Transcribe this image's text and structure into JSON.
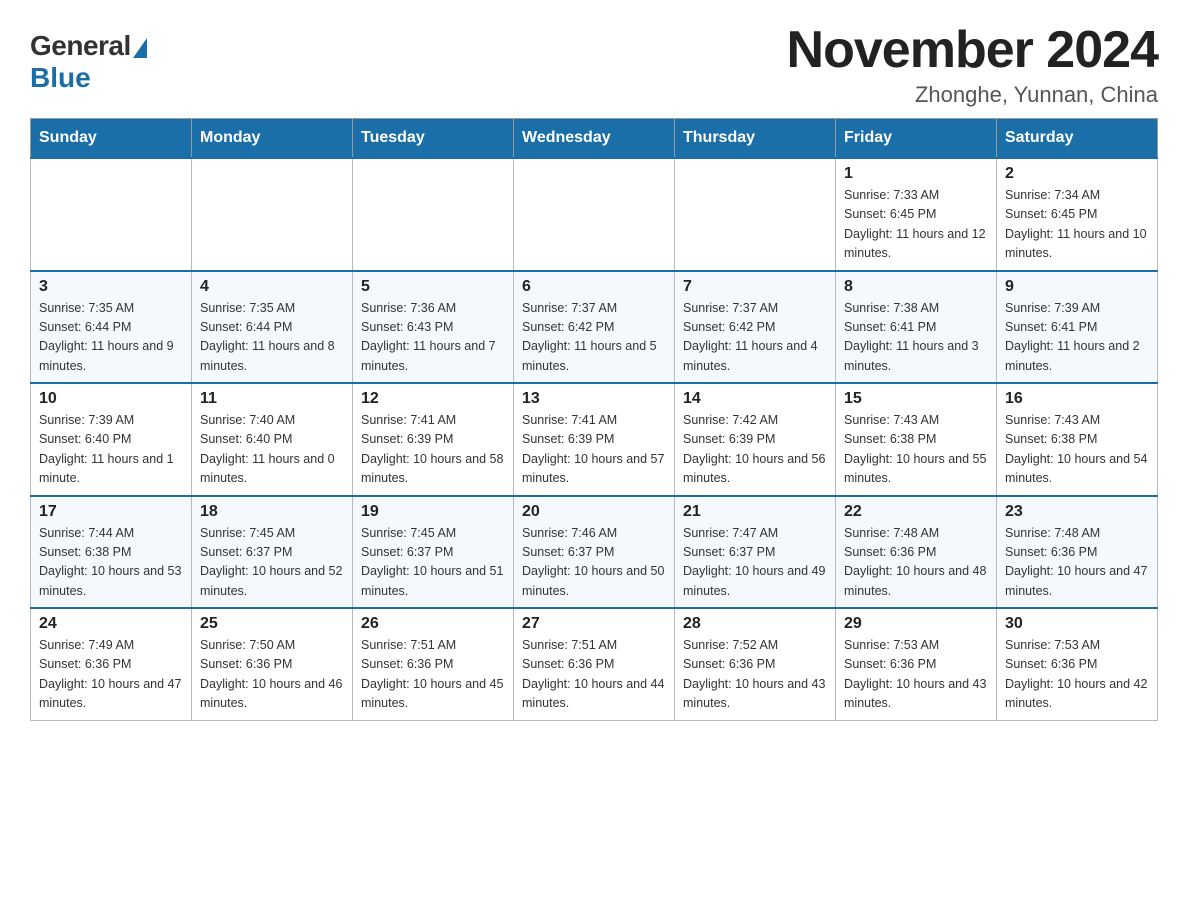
{
  "logo": {
    "general": "General",
    "blue": "Blue"
  },
  "title": "November 2024",
  "location": "Zhonghe, Yunnan, China",
  "days_of_week": [
    "Sunday",
    "Monday",
    "Tuesday",
    "Wednesday",
    "Thursday",
    "Friday",
    "Saturday"
  ],
  "weeks": [
    [
      {
        "day": "",
        "sunrise": "",
        "sunset": "",
        "daylight": ""
      },
      {
        "day": "",
        "sunrise": "",
        "sunset": "",
        "daylight": ""
      },
      {
        "day": "",
        "sunrise": "",
        "sunset": "",
        "daylight": ""
      },
      {
        "day": "",
        "sunrise": "",
        "sunset": "",
        "daylight": ""
      },
      {
        "day": "",
        "sunrise": "",
        "sunset": "",
        "daylight": ""
      },
      {
        "day": "1",
        "sunrise": "Sunrise: 7:33 AM",
        "sunset": "Sunset: 6:45 PM",
        "daylight": "Daylight: 11 hours and 12 minutes."
      },
      {
        "day": "2",
        "sunrise": "Sunrise: 7:34 AM",
        "sunset": "Sunset: 6:45 PM",
        "daylight": "Daylight: 11 hours and 10 minutes."
      }
    ],
    [
      {
        "day": "3",
        "sunrise": "Sunrise: 7:35 AM",
        "sunset": "Sunset: 6:44 PM",
        "daylight": "Daylight: 11 hours and 9 minutes."
      },
      {
        "day": "4",
        "sunrise": "Sunrise: 7:35 AM",
        "sunset": "Sunset: 6:44 PM",
        "daylight": "Daylight: 11 hours and 8 minutes."
      },
      {
        "day": "5",
        "sunrise": "Sunrise: 7:36 AM",
        "sunset": "Sunset: 6:43 PM",
        "daylight": "Daylight: 11 hours and 7 minutes."
      },
      {
        "day": "6",
        "sunrise": "Sunrise: 7:37 AM",
        "sunset": "Sunset: 6:42 PM",
        "daylight": "Daylight: 11 hours and 5 minutes."
      },
      {
        "day": "7",
        "sunrise": "Sunrise: 7:37 AM",
        "sunset": "Sunset: 6:42 PM",
        "daylight": "Daylight: 11 hours and 4 minutes."
      },
      {
        "day": "8",
        "sunrise": "Sunrise: 7:38 AM",
        "sunset": "Sunset: 6:41 PM",
        "daylight": "Daylight: 11 hours and 3 minutes."
      },
      {
        "day": "9",
        "sunrise": "Sunrise: 7:39 AM",
        "sunset": "Sunset: 6:41 PM",
        "daylight": "Daylight: 11 hours and 2 minutes."
      }
    ],
    [
      {
        "day": "10",
        "sunrise": "Sunrise: 7:39 AM",
        "sunset": "Sunset: 6:40 PM",
        "daylight": "Daylight: 11 hours and 1 minute."
      },
      {
        "day": "11",
        "sunrise": "Sunrise: 7:40 AM",
        "sunset": "Sunset: 6:40 PM",
        "daylight": "Daylight: 11 hours and 0 minutes."
      },
      {
        "day": "12",
        "sunrise": "Sunrise: 7:41 AM",
        "sunset": "Sunset: 6:39 PM",
        "daylight": "Daylight: 10 hours and 58 minutes."
      },
      {
        "day": "13",
        "sunrise": "Sunrise: 7:41 AM",
        "sunset": "Sunset: 6:39 PM",
        "daylight": "Daylight: 10 hours and 57 minutes."
      },
      {
        "day": "14",
        "sunrise": "Sunrise: 7:42 AM",
        "sunset": "Sunset: 6:39 PM",
        "daylight": "Daylight: 10 hours and 56 minutes."
      },
      {
        "day": "15",
        "sunrise": "Sunrise: 7:43 AM",
        "sunset": "Sunset: 6:38 PM",
        "daylight": "Daylight: 10 hours and 55 minutes."
      },
      {
        "day": "16",
        "sunrise": "Sunrise: 7:43 AM",
        "sunset": "Sunset: 6:38 PM",
        "daylight": "Daylight: 10 hours and 54 minutes."
      }
    ],
    [
      {
        "day": "17",
        "sunrise": "Sunrise: 7:44 AM",
        "sunset": "Sunset: 6:38 PM",
        "daylight": "Daylight: 10 hours and 53 minutes."
      },
      {
        "day": "18",
        "sunrise": "Sunrise: 7:45 AM",
        "sunset": "Sunset: 6:37 PM",
        "daylight": "Daylight: 10 hours and 52 minutes."
      },
      {
        "day": "19",
        "sunrise": "Sunrise: 7:45 AM",
        "sunset": "Sunset: 6:37 PM",
        "daylight": "Daylight: 10 hours and 51 minutes."
      },
      {
        "day": "20",
        "sunrise": "Sunrise: 7:46 AM",
        "sunset": "Sunset: 6:37 PM",
        "daylight": "Daylight: 10 hours and 50 minutes."
      },
      {
        "day": "21",
        "sunrise": "Sunrise: 7:47 AM",
        "sunset": "Sunset: 6:37 PM",
        "daylight": "Daylight: 10 hours and 49 minutes."
      },
      {
        "day": "22",
        "sunrise": "Sunrise: 7:48 AM",
        "sunset": "Sunset: 6:36 PM",
        "daylight": "Daylight: 10 hours and 48 minutes."
      },
      {
        "day": "23",
        "sunrise": "Sunrise: 7:48 AM",
        "sunset": "Sunset: 6:36 PM",
        "daylight": "Daylight: 10 hours and 47 minutes."
      }
    ],
    [
      {
        "day": "24",
        "sunrise": "Sunrise: 7:49 AM",
        "sunset": "Sunset: 6:36 PM",
        "daylight": "Daylight: 10 hours and 47 minutes."
      },
      {
        "day": "25",
        "sunrise": "Sunrise: 7:50 AM",
        "sunset": "Sunset: 6:36 PM",
        "daylight": "Daylight: 10 hours and 46 minutes."
      },
      {
        "day": "26",
        "sunrise": "Sunrise: 7:51 AM",
        "sunset": "Sunset: 6:36 PM",
        "daylight": "Daylight: 10 hours and 45 minutes."
      },
      {
        "day": "27",
        "sunrise": "Sunrise: 7:51 AM",
        "sunset": "Sunset: 6:36 PM",
        "daylight": "Daylight: 10 hours and 44 minutes."
      },
      {
        "day": "28",
        "sunrise": "Sunrise: 7:52 AM",
        "sunset": "Sunset: 6:36 PM",
        "daylight": "Daylight: 10 hours and 43 minutes."
      },
      {
        "day": "29",
        "sunrise": "Sunrise: 7:53 AM",
        "sunset": "Sunset: 6:36 PM",
        "daylight": "Daylight: 10 hours and 43 minutes."
      },
      {
        "day": "30",
        "sunrise": "Sunrise: 7:53 AM",
        "sunset": "Sunset: 6:36 PM",
        "daylight": "Daylight: 10 hours and 42 minutes."
      }
    ]
  ]
}
